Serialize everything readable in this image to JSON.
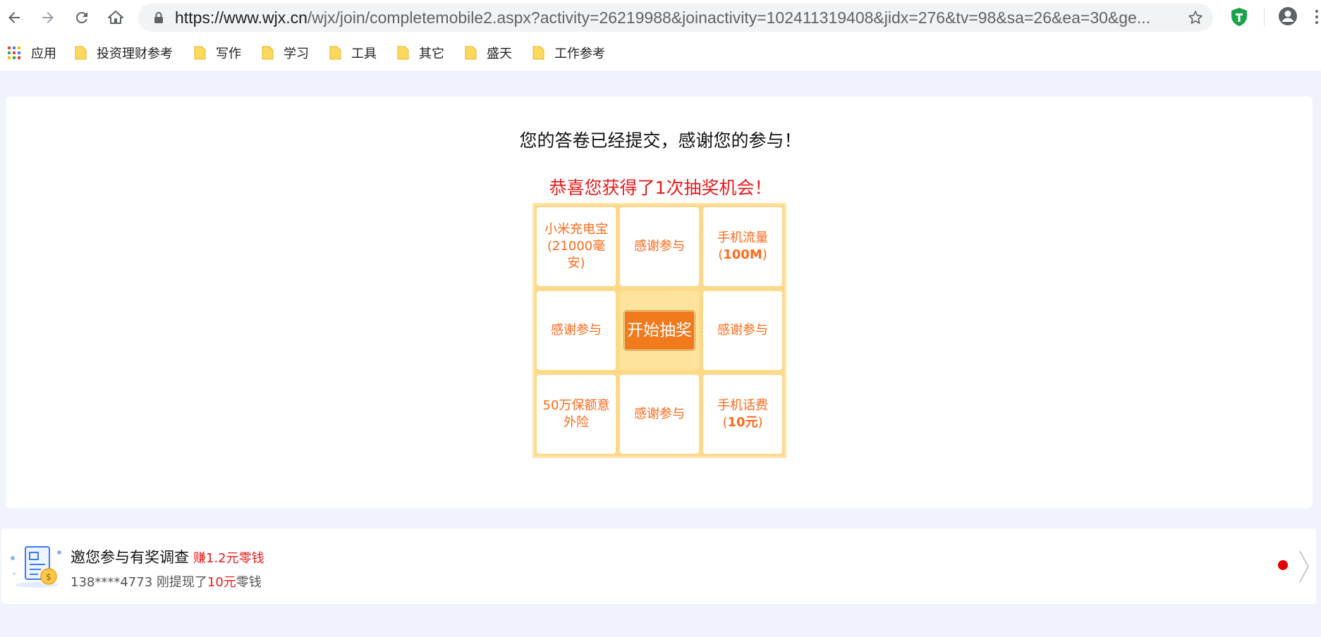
{
  "browser": {
    "url_host": "https://www.wjx.cn",
    "url_path": "/wjx/join/completemobile2.aspx?activity=26219988&joinactivity=102411319408&jidx=276&tv=98&sa=26&ea=30&ge...",
    "bookmarks": [
      {
        "label": "应用",
        "icon": "apps-grid-icon"
      },
      {
        "label": "投资理财参考",
        "icon": "folder-icon"
      },
      {
        "label": "写作",
        "icon": "folder-icon"
      },
      {
        "label": "学习",
        "icon": "folder-icon"
      },
      {
        "label": "工具",
        "icon": "folder-icon"
      },
      {
        "label": "其它",
        "icon": "folder-icon"
      },
      {
        "label": "盛天",
        "icon": "folder-icon"
      },
      {
        "label": "工作参考",
        "icon": "folder-icon"
      }
    ]
  },
  "page": {
    "thanks": "您的答卷已经提交，感谢您的参与！",
    "congrats": "恭喜您获得了1次抽奖机会！",
    "lottery": {
      "prizes": {
        "p1_line1": "小米充电宝",
        "p1_line2": "(21000毫安)",
        "p2": "感谢参与",
        "p3_line1": "手机流量",
        "p3_open": "(",
        "p3_bold": "100M",
        "p3_close": ")",
        "p4": "感谢参与",
        "p6": "感谢参与",
        "p7_line1": "50万保额意",
        "p7_line2": "外险",
        "p8": "感谢参与",
        "p9_line1": "手机话费",
        "p9_open": "(",
        "p9_bold": "10元",
        "p9_close": ")"
      },
      "start_label": "开始抽奖"
    },
    "ad": {
      "title": "邀您参与有奖调查",
      "reward": "赚1.2元零钱",
      "sub_prefix": "138****4773 刚提现了",
      "sub_amount": "10元",
      "sub_suffix": "零钱"
    }
  },
  "colors": {
    "page_bg": "#f0f3fb",
    "red_text": "#e61c1c",
    "prize_text": "#ff6a1a",
    "button_orange": "#f07a1c",
    "grid_bg": "#ffd98a"
  }
}
